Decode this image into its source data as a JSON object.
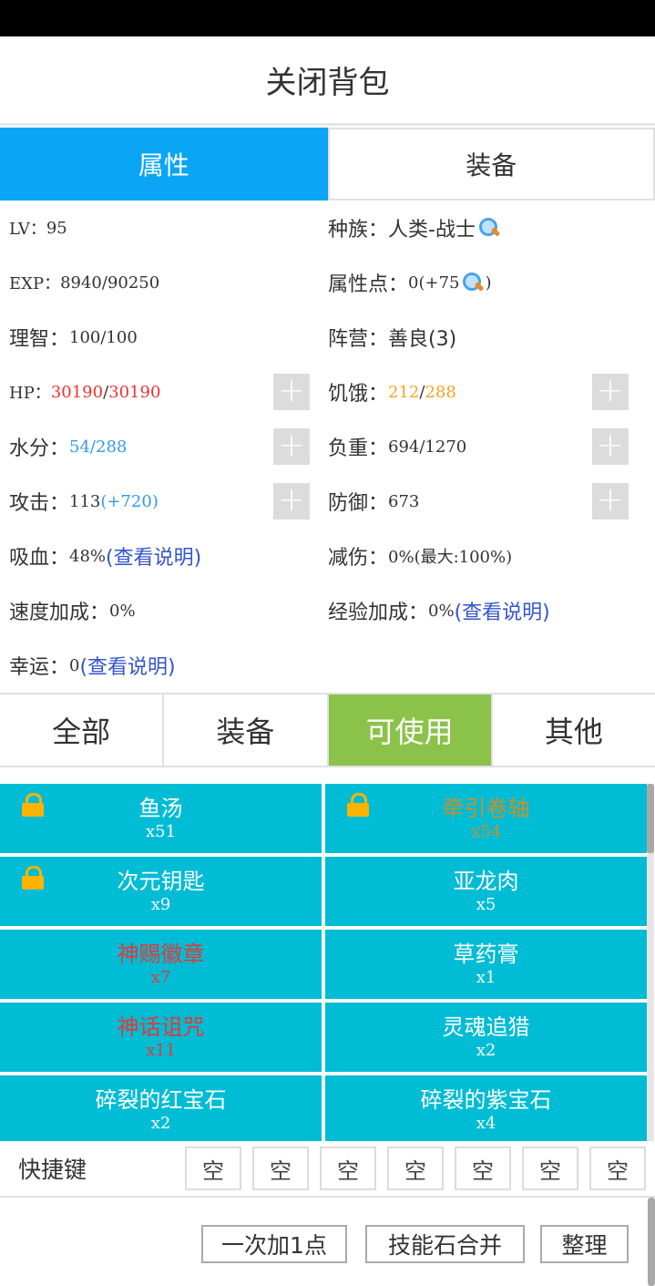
{
  "header": {
    "title": "关闭背包"
  },
  "main_tabs": [
    {
      "label": "属性",
      "active": true
    },
    {
      "label": "装备",
      "active": false
    }
  ],
  "attributes": {
    "lv": {
      "label": "LV：",
      "value": "95"
    },
    "race": {
      "label": "种族：",
      "value": "人类-战士"
    },
    "exp": {
      "label": "EXP：",
      "value": "8940/90250"
    },
    "attr_points": {
      "label": "属性点：",
      "value": "0(+75",
      "suffix": ")"
    },
    "sanity": {
      "label": "理智：",
      "value": "100/100"
    },
    "camp": {
      "label": "阵营：",
      "value": "善良(3)"
    },
    "hp": {
      "label": "HP：",
      "current": "30190",
      "sep": "/",
      "max": "30190"
    },
    "hunger": {
      "label": "饥饿：",
      "current": "212",
      "sep": "/",
      "max": "288"
    },
    "water": {
      "label": "水分：",
      "current": "54",
      "sep": "/",
      "max": "288"
    },
    "load": {
      "label": "负重：",
      "value": "694/1270"
    },
    "attack": {
      "label": "攻击：",
      "value": "113 ",
      "bonus": "(+720)"
    },
    "defense": {
      "label": "防御：",
      "value": "673"
    },
    "lifesteal": {
      "label": "吸血：",
      "value": "48%",
      "link": "(查看说明)"
    },
    "damage_reduction": {
      "label": "减伤：",
      "value": "0%(最大:100%)"
    },
    "speed_bonus": {
      "label": "速度加成：",
      "value": "0%"
    },
    "exp_bonus": {
      "label": "经验加成：",
      "value": "0%",
      "link": "(查看说明)"
    },
    "luck": {
      "label": "幸运：",
      "value": "0",
      "link": "(查看说明)"
    },
    "plus_symbol": "+"
  },
  "filter_tabs": [
    {
      "label": "全部",
      "active": false
    },
    {
      "label": "装备",
      "active": false
    },
    {
      "label": "可使用",
      "active": true
    },
    {
      "label": "其他",
      "active": false
    }
  ],
  "items": [
    {
      "name": "鱼汤",
      "qty": "x51",
      "locked": true,
      "color": "white"
    },
    {
      "name": "牵引卷轴",
      "qty": "x54",
      "locked": true,
      "color": "gold"
    },
    {
      "name": "次元钥匙",
      "qty": "x9",
      "locked": true,
      "color": "white"
    },
    {
      "name": "亚龙肉",
      "qty": "x5",
      "locked": false,
      "color": "white"
    },
    {
      "name": "神赐徽章",
      "qty": "x7",
      "locked": false,
      "color": "red"
    },
    {
      "name": "草药膏",
      "qty": "x1",
      "locked": false,
      "color": "white"
    },
    {
      "name": "神话诅咒",
      "qty": "x11",
      "locked": false,
      "color": "red"
    },
    {
      "name": "灵魂追猎",
      "qty": "x2",
      "locked": false,
      "color": "white"
    },
    {
      "name": "碎裂的红宝石",
      "qty": "x2",
      "locked": false,
      "color": "white"
    },
    {
      "name": "碎裂的紫宝石",
      "qty": "x4",
      "locked": false,
      "color": "white"
    }
  ],
  "shortcut": {
    "label": "快捷键",
    "slots": [
      "空",
      "空",
      "空",
      "空",
      "空",
      "空",
      "空"
    ]
  },
  "actions": {
    "add_one": "一次加1点",
    "merge_stones": "技能石合并",
    "sort": "整理"
  },
  "colors": {
    "tab_active": "#0aa5f5",
    "filter_active": "#8bc34a",
    "item_bg": "#00bcd4",
    "hp": "#ee3333",
    "hunger": "#f5a623",
    "water": "#3399ee",
    "link": "#3355cc"
  }
}
